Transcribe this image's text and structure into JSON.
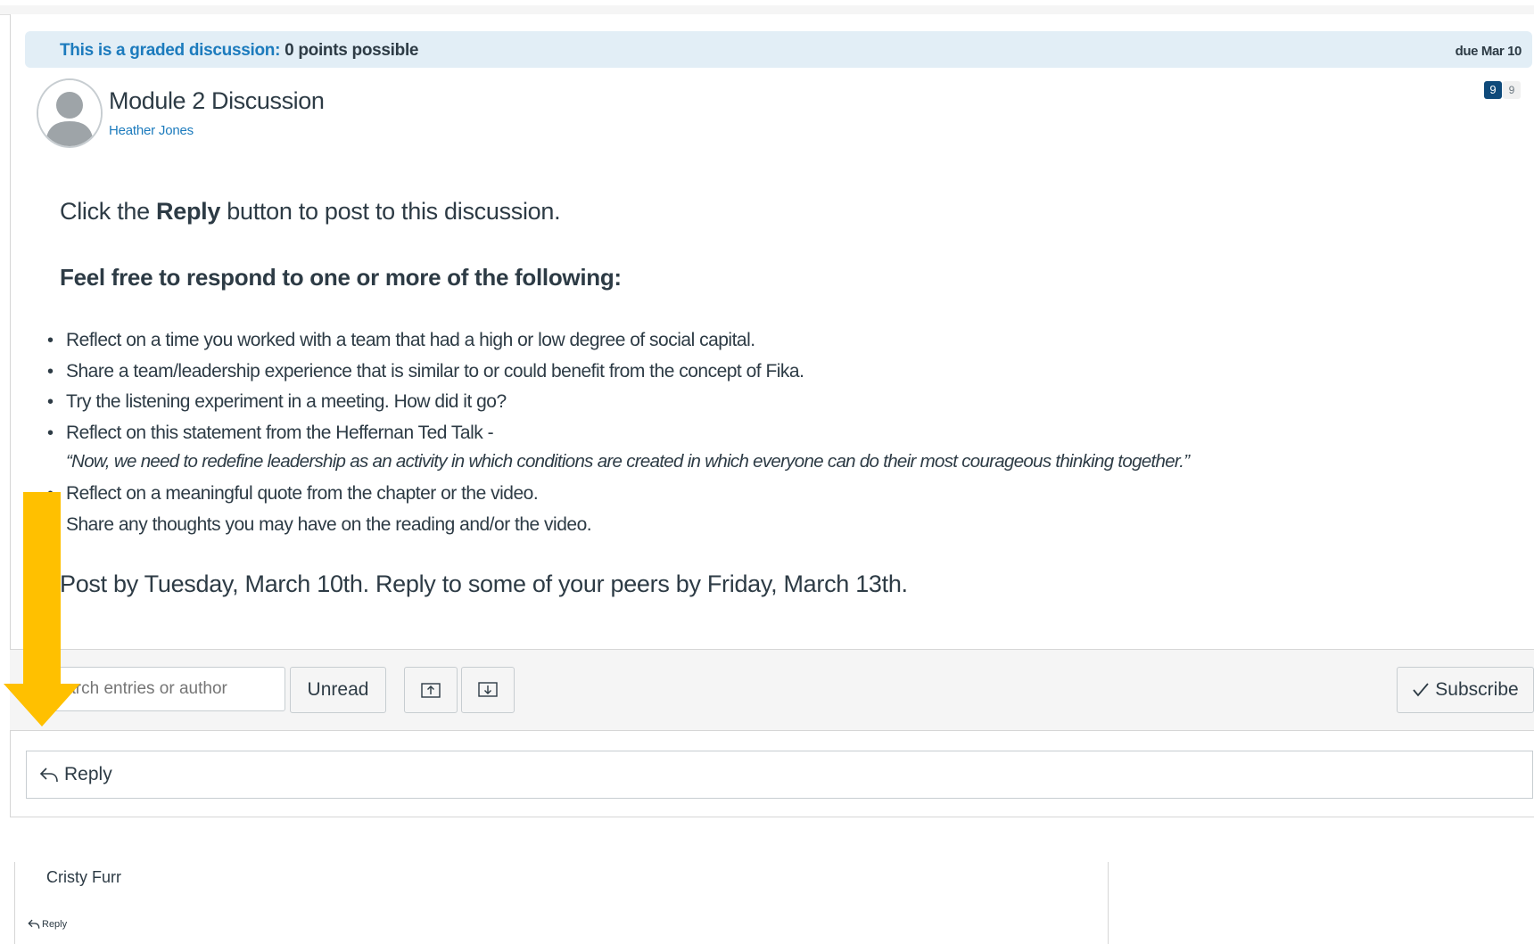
{
  "graded": {
    "link_text": "This is a graded discussion:",
    "points_text": "0 points possible",
    "due": "due Mar 10"
  },
  "topic": {
    "title": "Module 2 Discussion",
    "author": "Heather Jones",
    "unread_count": "9",
    "total_count": "9"
  },
  "body": {
    "intro_before": "Click the ",
    "intro_bold": "Reply",
    "intro_after": " button to post to this discussion.",
    "prompt_heading": "Feel free to respond to one or more of the following:",
    "bullets": [
      "Reflect on a time you worked with a team that had a high or low degree of social capital.",
      "Share a team/leadership experience that is similar to or could benefit from the concept of Fika.",
      "Try the listening experiment in a meeting. How did it go?",
      "Reflect on this statement from the Heffernan Ted Talk -"
    ],
    "quote": "“Now, we need to redefine leadership as an activity in which conditions are created in which everyone can do their most courageous thinking together.”",
    "bullets_after": [
      "Reflect on a meaningful quote from the chapter or the video.",
      "Share any thoughts you may have on the reading and/or the video."
    ],
    "deadline": "Post by Tuesday, March 10th. Reply to some of your peers by Friday, March 13th."
  },
  "toolbar": {
    "search_placeholder": "Search entries or author",
    "unread_label": "Unread",
    "collapse_icon": "collapse-threads-icon",
    "expand_icon": "expand-threads-icon",
    "subscribe_label": "Subscribe"
  },
  "reply": {
    "label": "Reply"
  },
  "entry": {
    "author": "Cristy Furr",
    "reply_label": "Reply"
  },
  "colors": {
    "link": "#1c7bbd",
    "graded_bar": "#e2eef6",
    "count_badge": "#0f4a7a",
    "arrow": "#ffc000"
  }
}
